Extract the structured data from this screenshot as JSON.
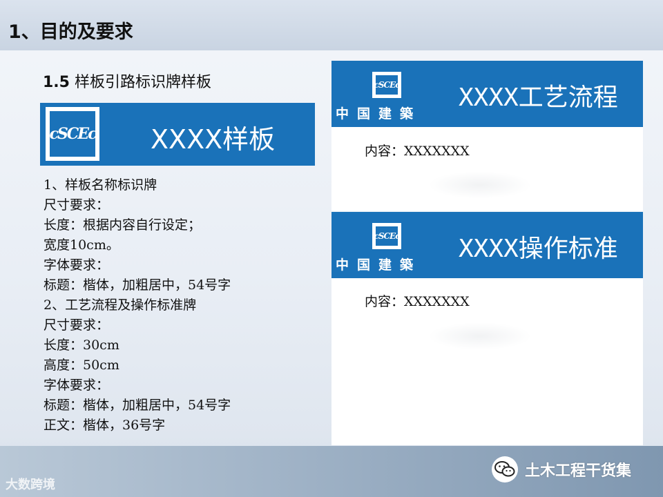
{
  "slide": {
    "title": "1、目的及要求",
    "subtitle_number": "1.5",
    "subtitle_text": "样板引路标识牌样板"
  },
  "sample_sign": {
    "logo_text": "cSCEc",
    "title": "XXXX样板"
  },
  "requirements": [
    "1、样板名称标识牌",
    "尺寸要求：",
    "长度：根据内容自行设定；",
    "宽度10cm。",
    "字体要求：",
    "标题：楷体，加粗居中，54号字",
    "2、工艺流程及操作标准牌",
    "尺寸要求：",
    "长度：30cm",
    "高度：50cm",
    "字体要求：",
    "标题：楷体，加粗居中，54号字",
    "正文：楷体，36号字"
  ],
  "cards": [
    {
      "logo_text": "cSCEc",
      "brand": "中国建築",
      "title": "XXXX工艺流程",
      "content": "内容：XXXXXXX"
    },
    {
      "logo_text": "cSCEc",
      "brand": "中国建築",
      "title": "XXXX操作标准",
      "content": "内容：XXXXXXX"
    }
  ],
  "footer": {
    "left_text": "大数跨境",
    "right_text": "土木工程干货集",
    "icon": "wechat-icon"
  },
  "colors": {
    "brand_blue": "#1a72b9"
  }
}
